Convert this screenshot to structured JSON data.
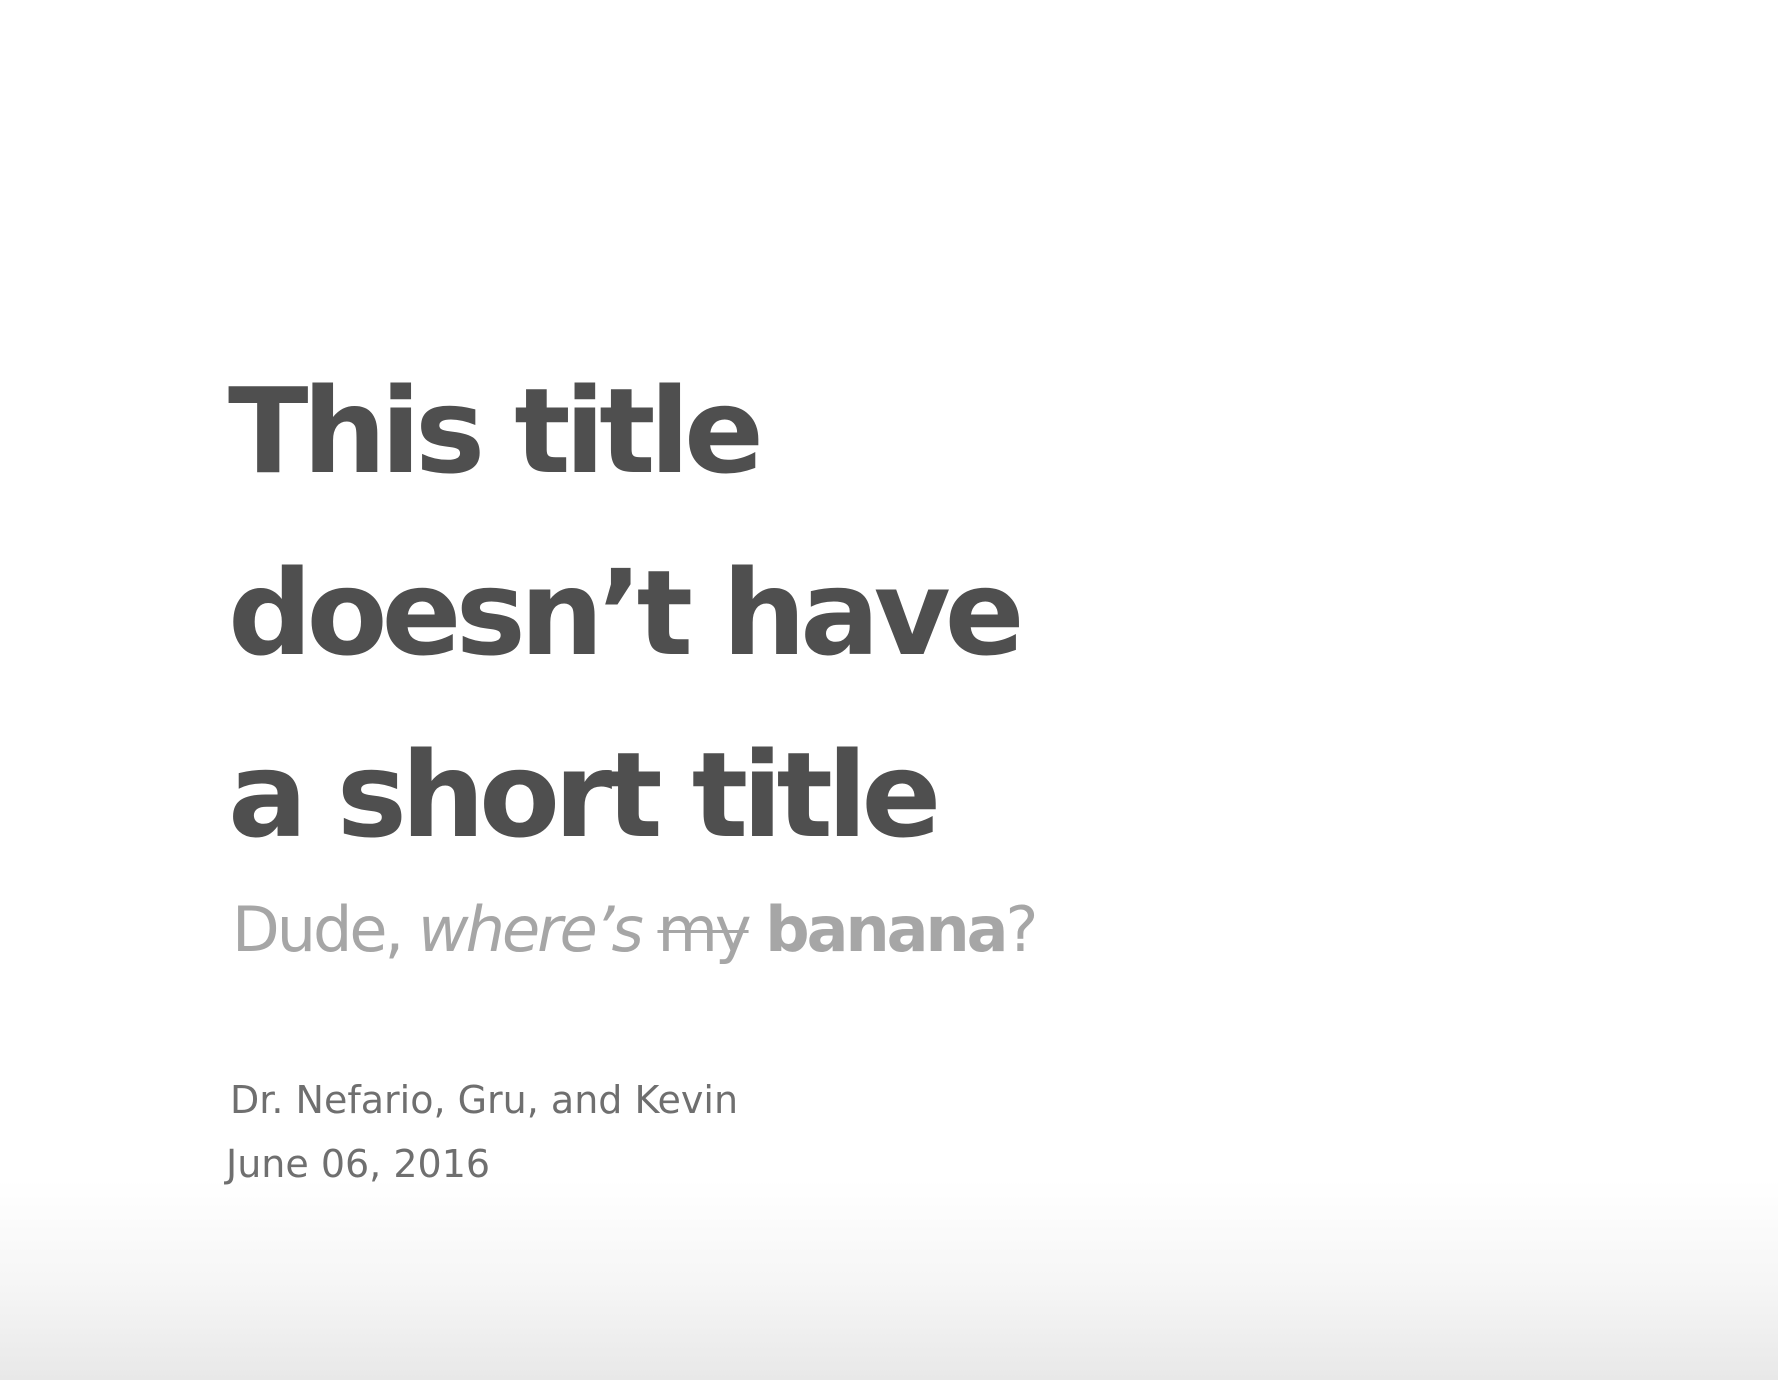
{
  "slide": {
    "title_lines": [
      "This title",
      "doesn’t have",
      "a short title"
    ],
    "subtitle": {
      "part1": "Dude, ",
      "part2_italic": "where’s",
      "part3": " ",
      "part4_strike": "my",
      "part5": " ",
      "part6_bold": "banana",
      "part7": "?"
    },
    "author": "Dr. Nefario, Gru, and Kevin",
    "date": "June 06, 2016"
  },
  "colors": {
    "title": "#4f4f4f",
    "subtitle": "#a6a6a6",
    "meta": "#6f6f6f"
  }
}
